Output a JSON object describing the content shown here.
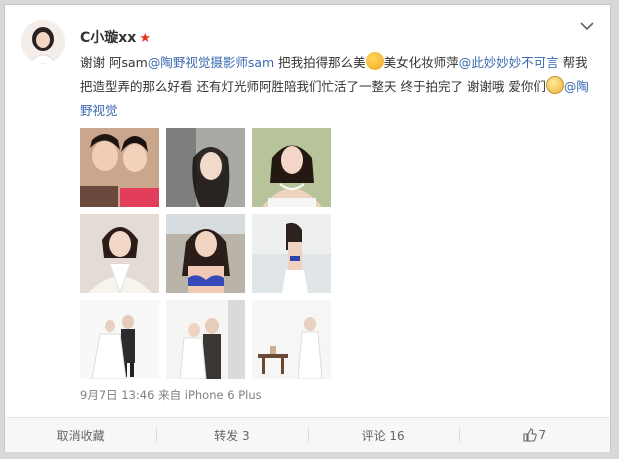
{
  "post": {
    "username": "C小璇xx",
    "verified_badge": "★",
    "text": {
      "part1": "谢谢 阿sam",
      "mention1": "@陶野视觉摄影师sam",
      "part2": " 把我拍得那么美",
      "part3": "美女化妆师萍",
      "mention2": "@此妙妙妙不可言",
      "part4": " 帮我把造型弄的那么好看  还有灯光师阿胜陪我们忙活了一整天  终于拍完了 谢谢哦 爱你们",
      "mention3": "@陶野视觉"
    },
    "photos": [
      {
        "name": "photo-two-girls-selfie"
      },
      {
        "name": "photo-car-portrait"
      },
      {
        "name": "photo-necklace-portrait"
      },
      {
        "name": "photo-white-halter-portrait"
      },
      {
        "name": "photo-beach-bikini-portrait"
      },
      {
        "name": "photo-seaside-back-view"
      },
      {
        "name": "photo-couple-studio"
      },
      {
        "name": "photo-couple-studio-2"
      },
      {
        "name": "photo-bride-studio-table"
      }
    ],
    "time": "9月7日 13:46",
    "source_prefix": "来自",
    "source": "iPhone 6 Plus"
  },
  "actions": {
    "unfavorite": "取消收藏",
    "repost": "转发 3",
    "comment": "评论 16",
    "like": "7"
  },
  "colors": {
    "link": "#3b6ab0",
    "badge": "#e8321e",
    "text": "#333333"
  }
}
